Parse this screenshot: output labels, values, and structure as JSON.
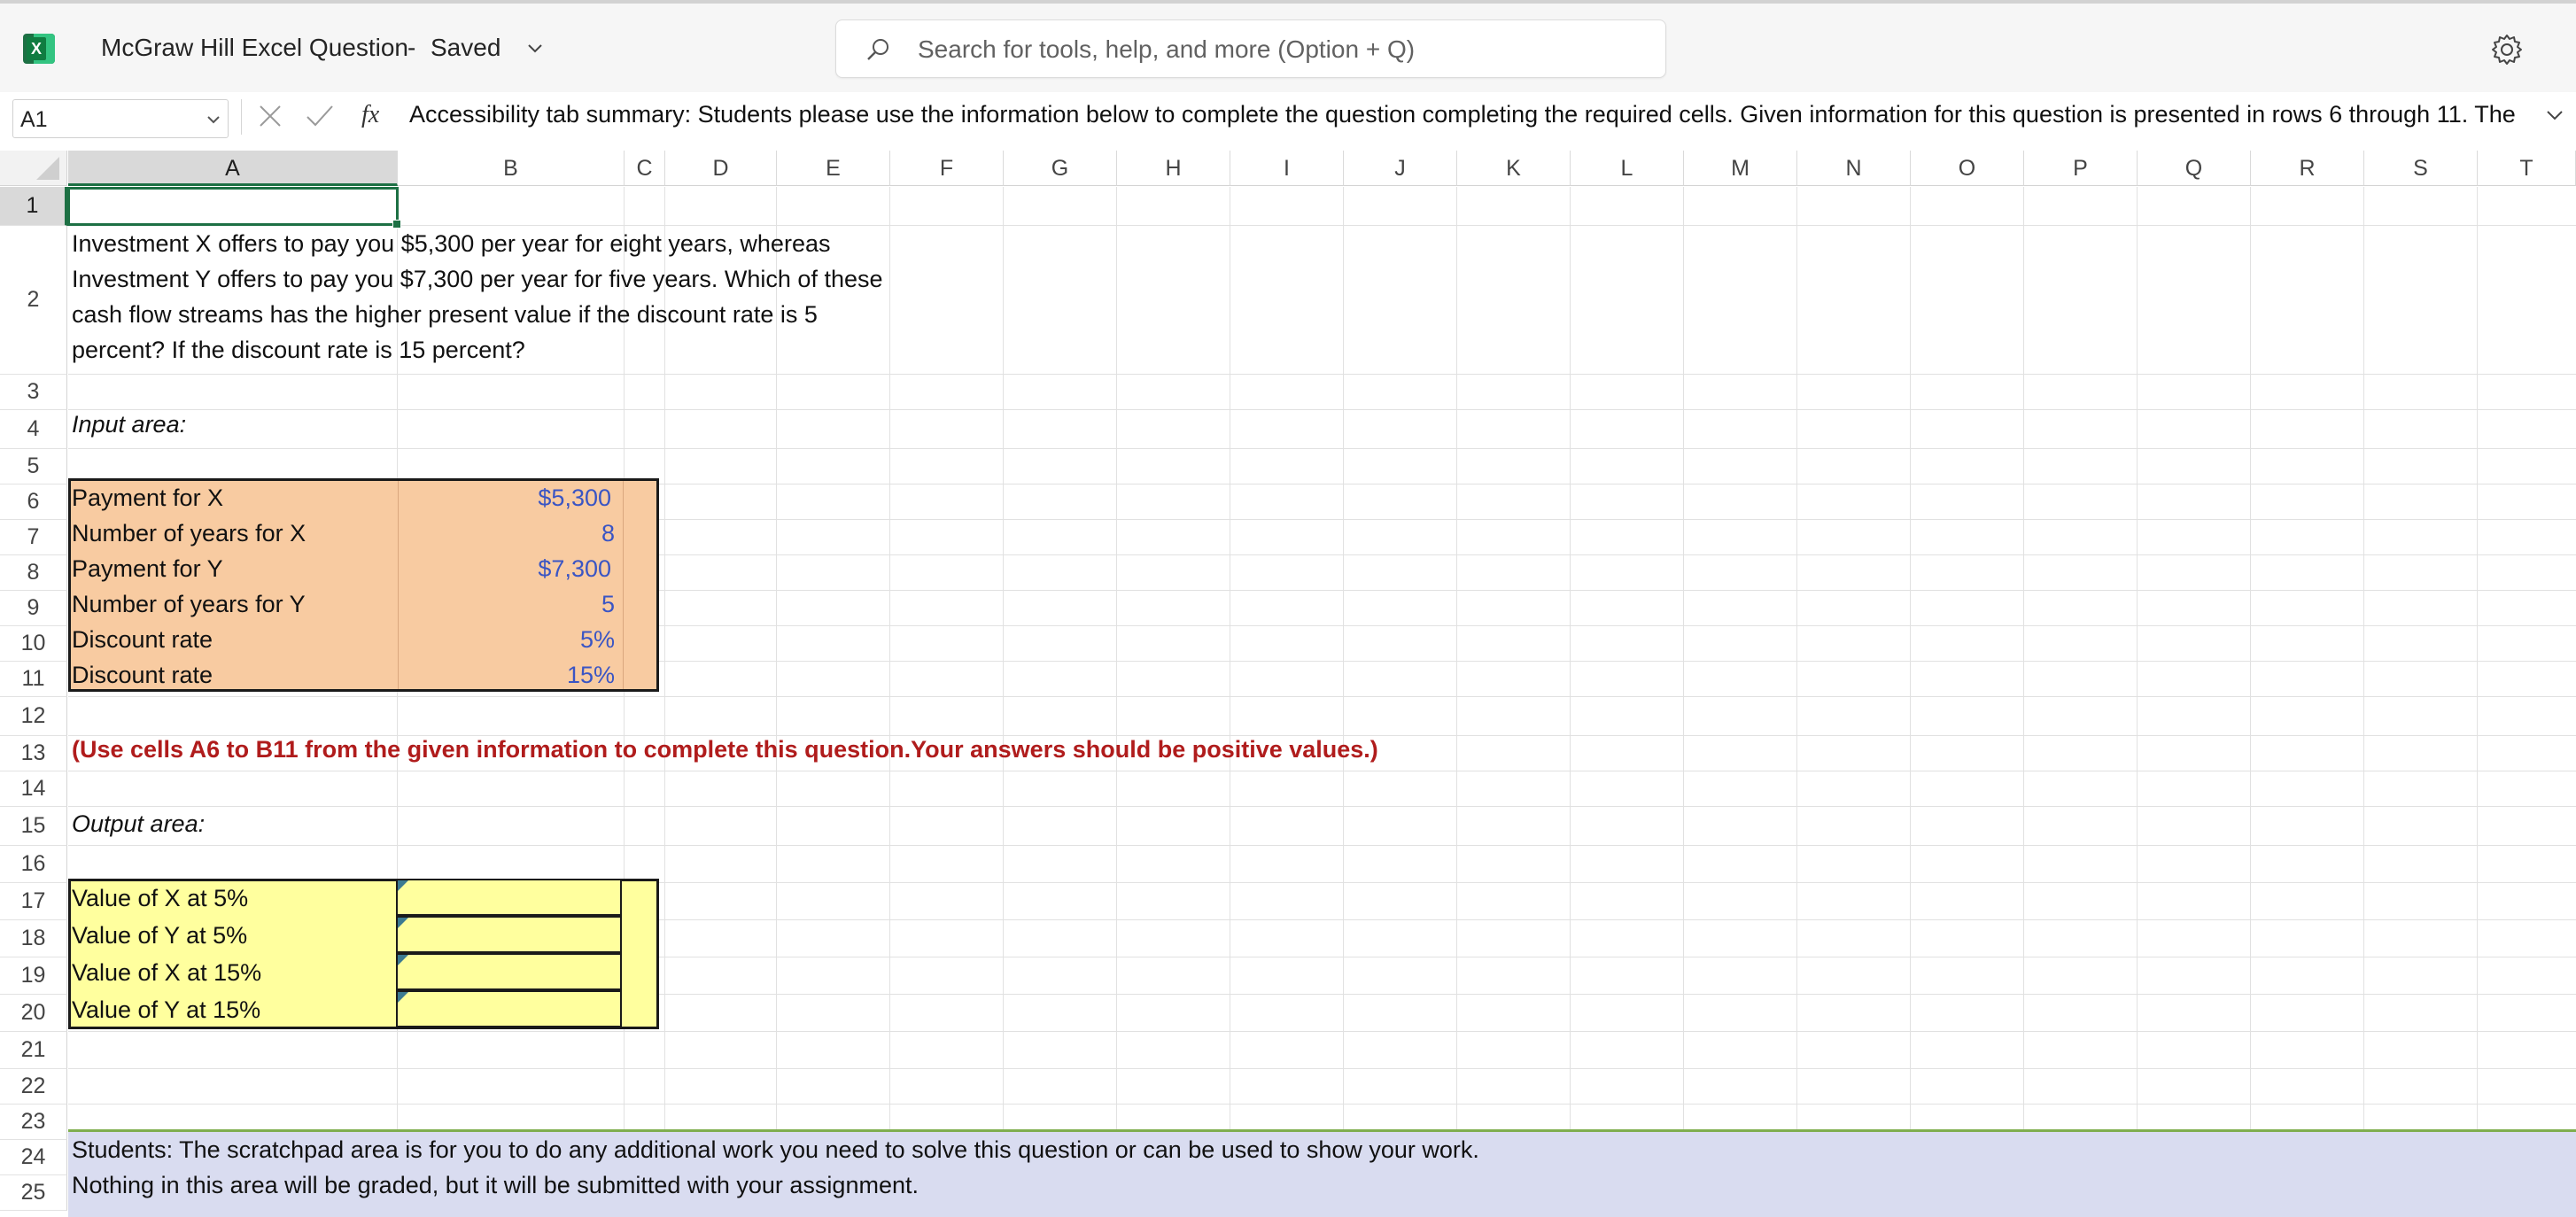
{
  "app": {
    "document_title": "McGraw Hill Excel Question",
    "separator": "-",
    "save_status": "Saved",
    "search_placeholder": "Search for tools, help, and more (Option + Q)"
  },
  "formula_bar": {
    "name_box": "A1",
    "fx_label": "fx",
    "content": "Accessibility tab summary: Students please use the information below to complete the question completing the required cells. Given information for this question is presented in rows 6 through 11. The"
  },
  "columns": [
    "A",
    "B",
    "C",
    "D",
    "E",
    "F",
    "G",
    "H",
    "I",
    "J",
    "K",
    "L",
    "M",
    "N",
    "O",
    "P",
    "Q",
    "R",
    "S",
    "T"
  ],
  "rows": [
    "1",
    "2",
    "3",
    "4",
    "5",
    "6",
    "7",
    "8",
    "9",
    "10",
    "11",
    "12",
    "13",
    "14",
    "15",
    "16",
    "17",
    "18",
    "19",
    "20",
    "21",
    "22",
    "23",
    "24",
    "25"
  ],
  "sheet": {
    "question_lines": [
      "Investment X offers to pay you $5,300 per year for eight years, whereas",
      "Investment Y offers to pay you $7,300 per year for five years. Which of these",
      "cash flow streams has the higher present value if the discount rate is 5",
      "percent? If the discount rate is 15 percent?"
    ],
    "input_area_label": "Input area:",
    "inputs": [
      {
        "label": "Payment for X",
        "value": "$5,300"
      },
      {
        "label": "Number of years for X",
        "value": "8"
      },
      {
        "label": "Payment for Y",
        "value": "$7,300"
      },
      {
        "label": "Number of years for Y",
        "value": "5"
      },
      {
        "label": "Discount rate",
        "value": "5%"
      },
      {
        "label": "Discount rate",
        "value": "15%"
      }
    ],
    "instruction": "(Use cells A6 to B11 from the given information to complete this question.Your answers should be positive values.)",
    "output_area_label": "Output area:",
    "outputs": [
      {
        "label": "Value of X at 5%",
        "value": ""
      },
      {
        "label": "Value of Y at 5%",
        "value": ""
      },
      {
        "label": "Value of X at 15%",
        "value": ""
      },
      {
        "label": "Value of Y at 15%",
        "value": ""
      }
    ],
    "scratchpad_lines": [
      "Students: The scratchpad area is for you to do any additional work you need to solve this question or can be used to show your work.",
      "Nothing in this area will be graded, but it will be submitted with your assignment."
    ]
  },
  "colors": {
    "excel_green": "#1d7044",
    "input_fill": "#f8cba1",
    "output_fill": "#ffff9e",
    "scratch_fill": "#d9dcf0",
    "input_number_blue": "#3a55c4",
    "instruction_red": "#b01c1c"
  },
  "icons": [
    "excel-app-icon",
    "chevron-down-icon",
    "search-icon",
    "gear-icon",
    "cancel-icon",
    "check-icon",
    "fx-icon"
  ]
}
